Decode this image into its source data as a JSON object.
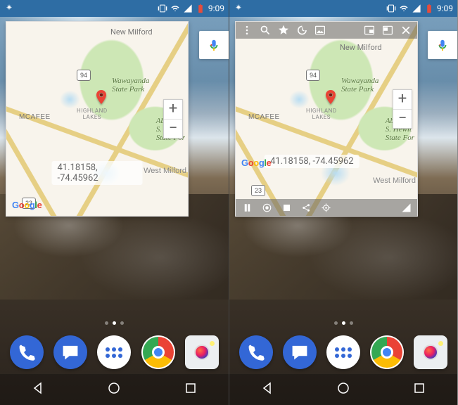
{
  "status": {
    "time": "9:09"
  },
  "map": {
    "labels": {
      "new_milford": "New Milford",
      "wawayanda": "Wawayanda\nState Park",
      "abram_hewitt": "Abram\nS. Hewit\nState For",
      "west_milford": "West Milford",
      "highland_lakes": "HIGHLAND\nLAKES",
      "mcafee": "MCAFEE",
      "route_94": "94",
      "route_23": "23"
    },
    "coords_text": "41.18158, -74.45962",
    "google": {
      "g": "G",
      "o1": "o",
      "o2": "o",
      "g2": "g",
      "l": "l",
      "e": "e"
    },
    "zoom": {
      "plus": "+",
      "minus": "−"
    },
    "pin": {
      "lat": 41.18158,
      "lon": -74.45962,
      "color": "#ea4335"
    }
  },
  "overlay": {
    "top": [
      {
        "name": "more",
        "icon": "more-vert-icon"
      },
      {
        "name": "search",
        "icon": "search-icon"
      },
      {
        "name": "star",
        "icon": "star-icon"
      },
      {
        "name": "history",
        "icon": "history-icon"
      },
      {
        "name": "image",
        "icon": "image-icon"
      },
      {
        "name": "picture-in",
        "icon": "picture-in-icon"
      },
      {
        "name": "picture-swap",
        "icon": "picture-swap-icon"
      },
      {
        "name": "close",
        "icon": "close-icon"
      }
    ],
    "bottom": [
      {
        "name": "pause",
        "icon": "pause-icon"
      },
      {
        "name": "record",
        "icon": "record-icon"
      },
      {
        "name": "stop",
        "icon": "stop-icon"
      },
      {
        "name": "share",
        "icon": "share-nodes-icon"
      },
      {
        "name": "locate",
        "icon": "mylocation-icon"
      },
      {
        "name": "signal",
        "icon": "cell-signal-icon"
      }
    ]
  },
  "dock": {
    "apps": [
      "phone",
      "messages",
      "app-drawer",
      "chrome",
      "camera"
    ]
  },
  "nav": {
    "back": "back",
    "home": "home",
    "recent": "recent"
  }
}
